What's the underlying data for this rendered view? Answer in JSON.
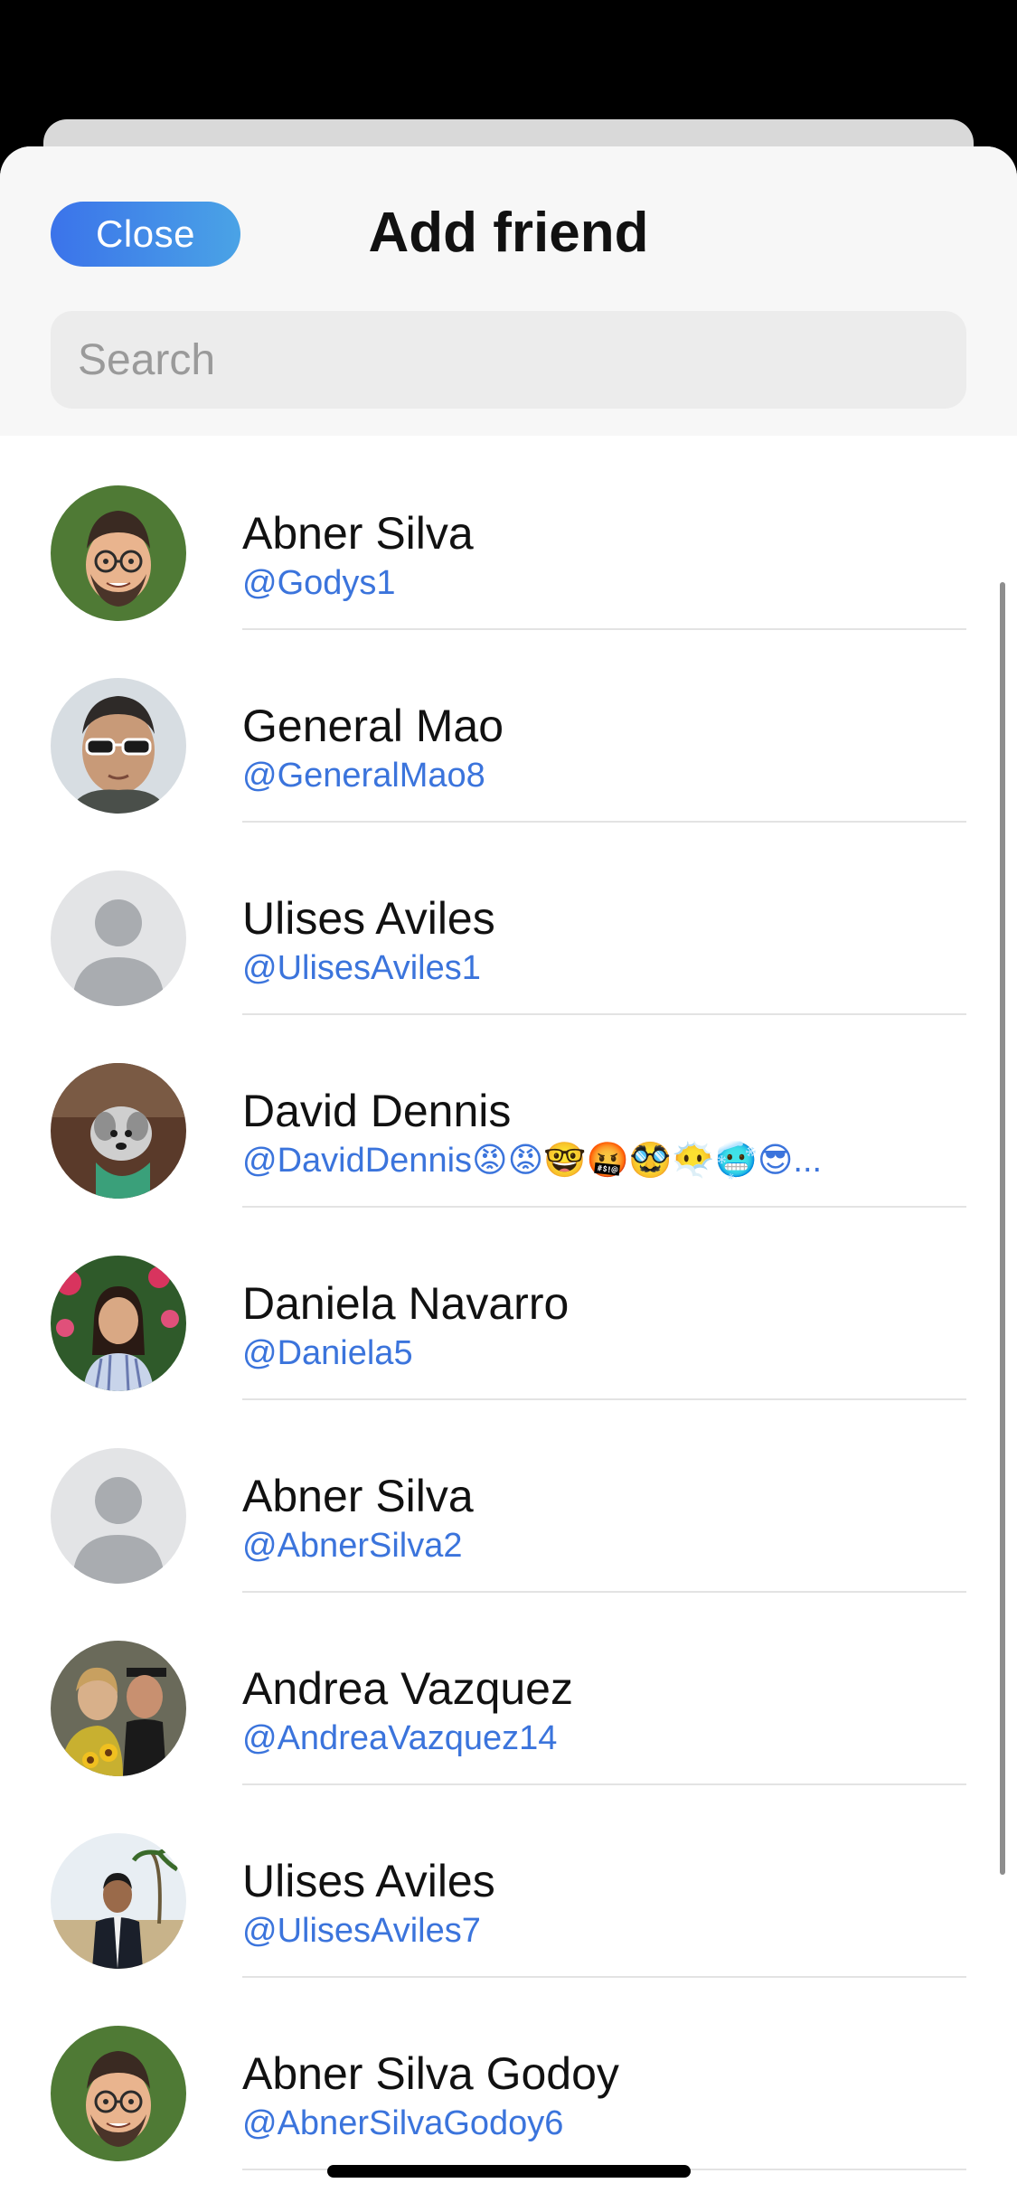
{
  "header": {
    "close_label": "Close",
    "title": "Add friend",
    "search_placeholder": "Search",
    "search_value": ""
  },
  "contacts": [
    {
      "name": "Abner Silva",
      "handle": "@Godys1",
      "avatar": "memoji-avatar"
    },
    {
      "name": "General Mao",
      "handle": "@GeneralMao8",
      "avatar": "portrait-sunglasses-avatar"
    },
    {
      "name": "Ulises Aviles",
      "handle": "@UlisesAviles1",
      "avatar": "default-person-avatar"
    },
    {
      "name": "David Dennis",
      "handle": "@DavidDennis😡😡🤓🤬🥸😶‍🌫️🥶😎...",
      "avatar": "dog-photo-avatar"
    },
    {
      "name": "Daniela Navarro",
      "handle": "@Daniela5",
      "avatar": "person-photo-avatar"
    },
    {
      "name": "Abner Silva",
      "handle": "@AbnerSilva2",
      "avatar": "default-person-avatar"
    },
    {
      "name": "Andrea Vazquez",
      "handle": "@AndreaVazquez14",
      "avatar": "graduation-photo-avatar"
    },
    {
      "name": "Ulises Aviles",
      "handle": "@UlisesAviles7",
      "avatar": "person-photo-avatar"
    },
    {
      "name": "Abner Silva Godoy",
      "handle": "@AbnerSilvaGodoy6",
      "avatar": "memoji-avatar"
    }
  ],
  "colors": {
    "accent": "#3b74dc",
    "close_gradient_start": "#3b73ea",
    "close_gradient_end": "#4aa3e6",
    "memoji_background": "#4f7a35"
  }
}
